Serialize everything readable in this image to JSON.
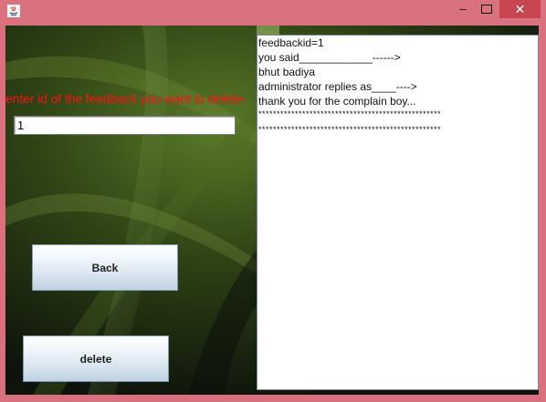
{
  "window": {
    "minimize_symbol": "‒",
    "close_symbol": "✕"
  },
  "form": {
    "prompt": "enter id of the feedback you want to delete-",
    "id_value": "1",
    "back_label": "Back",
    "delete_label": "delete"
  },
  "feedback": {
    "lines": [
      "feedbackid=1",
      "you said____________------>",
      "bhut badiya",
      "administrator replies as____---->",
      "thank you for the complain boy...",
      "**************************************************",
      "**************************************************"
    ]
  },
  "colors": {
    "title_bar": "#da717f",
    "close_button": "#c7464f",
    "prompt_text": "#ff1010"
  }
}
